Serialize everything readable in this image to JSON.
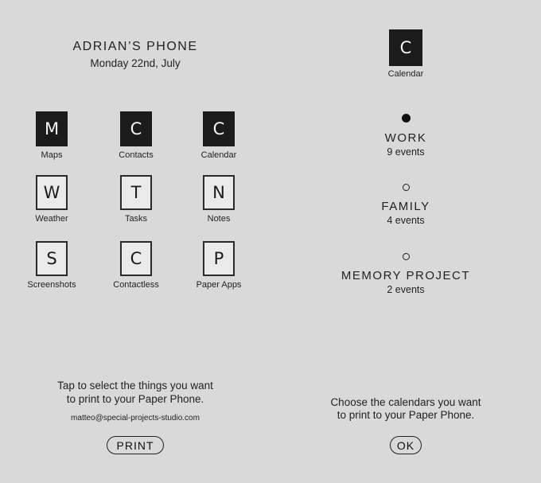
{
  "left": {
    "phone_name": "ADRIAN’S PHONE",
    "date": "Monday 22nd, July",
    "apps": [
      {
        "letter": "M",
        "label": "Maps",
        "selected": true
      },
      {
        "letter": "C",
        "label": "Contacts",
        "selected": true
      },
      {
        "letter": "C",
        "label": "Calendar",
        "selected": true
      },
      {
        "letter": "W",
        "label": "Weather",
        "selected": false
      },
      {
        "letter": "T",
        "label": "Tasks",
        "selected": false
      },
      {
        "letter": "N",
        "label": "Notes",
        "selected": false
      },
      {
        "letter": "S",
        "label": "Screenshots",
        "selected": false
      },
      {
        "letter": "C",
        "label": "Contactless",
        "selected": false
      },
      {
        "letter": "P",
        "label": "Paper Apps",
        "selected": false
      }
    ],
    "instruction_line1": "Tap to select the things you want",
    "instruction_line2": "to print to your Paper Phone.",
    "email": "matteo@special-projects-studio.com",
    "print_label": "PRINT"
  },
  "right": {
    "header_app": {
      "letter": "C",
      "label": "Calendar"
    },
    "calendars": [
      {
        "name": "WORK",
        "count": "9 events",
        "checked": true
      },
      {
        "name": "FAMILY",
        "count": "4 events",
        "checked": false
      },
      {
        "name": "MEMORY PROJECT",
        "count": "2 events",
        "checked": false
      }
    ],
    "instruction_line1": "Choose the calendars you want",
    "instruction_line2": "to print to your Paper Phone.",
    "ok_label": "OK"
  },
  "colors": {
    "background": "#d9d9d9",
    "tile_selected": "#1b1b1b",
    "tile_unselected": "#eaeaea",
    "ink": "#222222"
  }
}
